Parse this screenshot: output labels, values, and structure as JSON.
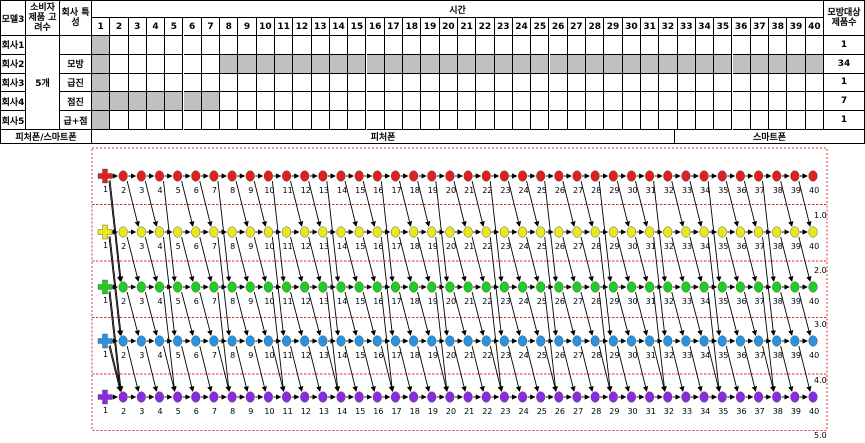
{
  "table": {
    "header": {
      "model": "모델3",
      "consumer": "소비자 제품 고려수",
      "company_char": "회사 특성",
      "time": "시간",
      "imitation": "모방대상 제품수"
    },
    "time_periods": [
      1,
      2,
      3,
      4,
      5,
      6,
      7,
      8,
      9,
      10,
      11,
      12,
      13,
      14,
      15,
      16,
      17,
      18,
      19,
      20,
      21,
      22,
      23,
      24,
      25,
      26,
      27,
      28,
      29,
      30,
      31,
      32,
      33,
      34,
      35,
      36,
      37,
      38,
      39,
      40
    ],
    "consumer_value": "5개",
    "rows": [
      {
        "company": "회사1",
        "trait": "",
        "count": "1",
        "shaded": [
          1
        ]
      },
      {
        "company": "회사2",
        "trait": "모방",
        "count": "34",
        "shaded": [
          1,
          8,
          9,
          10,
          11,
          12,
          13,
          14,
          15,
          16,
          17,
          18,
          19,
          20,
          21,
          22,
          23,
          24,
          25,
          26,
          27,
          28,
          29,
          30,
          31,
          32,
          33,
          34,
          35,
          36,
          37,
          38,
          39,
          40
        ]
      },
      {
        "company": "회사3",
        "trait": "급진",
        "count": "1",
        "shaded": [
          1
        ]
      },
      {
        "company": "회사4",
        "trait": "점진",
        "count": "7",
        "shaded": [
          1,
          2,
          3,
          4,
          5,
          6,
          7
        ]
      },
      {
        "company": "회사5",
        "trait": "급+점",
        "count": "1",
        "shaded": [
          1
        ]
      }
    ],
    "footer": {
      "left": "피처폰/스마트폰",
      "mid": "피처폰",
      "right": "스마트폰"
    }
  },
  "diagram": {
    "rows": [
      {
        "color": "#e02020",
        "level_label": ""
      },
      {
        "color": "#e8e820",
        "level_label": "1.0"
      },
      {
        "color": "#22cc22",
        "level_label": "2.0"
      },
      {
        "color": "#2a92e0",
        "level_label": "3.0"
      },
      {
        "color": "#8a2be2",
        "level_label": "4.0"
      }
    ],
    "bottom_label": "5.0",
    "first_col_label": "1"
  }
}
